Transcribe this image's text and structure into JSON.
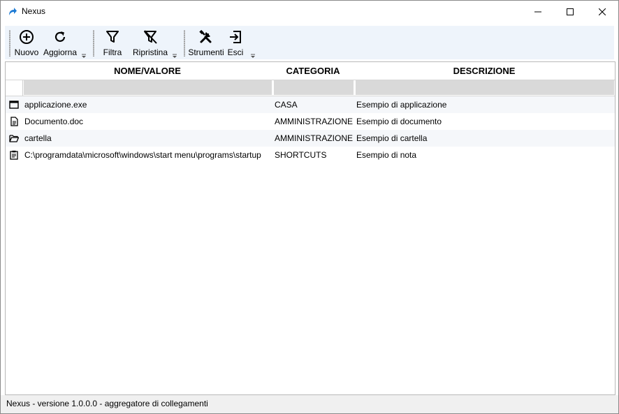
{
  "window": {
    "title": "Nexus"
  },
  "toolbar": {
    "new_label": "Nuovo",
    "refresh_label": "Aggiorna",
    "filter_label": "Filtra",
    "reset_label": "Ripristina",
    "tools_label": "Strumenti",
    "exit_label": "Esci"
  },
  "grid": {
    "columns": [
      "NOME/VALORE",
      "CATEGORIA",
      "DESCRIZIONE"
    ],
    "rows": [
      {
        "icon": "window-icon",
        "name": "applicazione.exe",
        "category": "CASA",
        "description": "Esempio di applicazione"
      },
      {
        "icon": "document-icon",
        "name": "Documento.doc",
        "category": "AMMINISTRAZIONE",
        "description": "Esempio di documento"
      },
      {
        "icon": "folder-open-icon",
        "name": "cartella",
        "category": "AMMINISTRAZIONE",
        "description": "Esempio di cartella"
      },
      {
        "icon": "clipboard-note-icon",
        "name": "C:\\programdata\\microsoft\\windows\\start menu\\programs\\startup",
        "category": "SHORTCUTS",
        "description": "Esempio di nota"
      }
    ]
  },
  "status": {
    "text": "Nexus - versione 1.0.0.0 - aggregatore di collegamenti"
  },
  "colors": {
    "accent": "#1e7bd4",
    "toolbar_bg": "#eef4fb",
    "filter_bg": "#d9d9d9"
  }
}
